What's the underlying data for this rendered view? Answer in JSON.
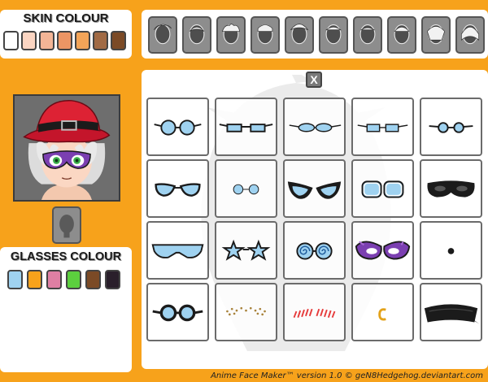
{
  "skin": {
    "title": "SKIN COLOUR",
    "colors": [
      "#ffffff",
      "#fbd5c2",
      "#f3b596",
      "#ec9564",
      "#f3a458",
      "#a16a44",
      "#7b4a26"
    ]
  },
  "hair": {
    "thumb_count": 10,
    "thumb_color": "#8d8d8d"
  },
  "glasses_colour": {
    "title": "GLASSES COLOUR",
    "colors": [
      "#9fd2f0",
      "#f7a21b",
      "#de7fa3",
      "#5ccf3e",
      "#7b4a26",
      "#2a1f2b"
    ]
  },
  "close_label": "X",
  "glasses_options": [
    "round-glasses",
    "rectangle-glasses",
    "small-oval-glasses",
    "small-rectangle-glasses",
    "round-small-glasses",
    "cat-eye-glasses",
    "wire-round-glasses",
    "black-cat-eye-mask",
    "square-frame-glasses",
    "black-eye-mask",
    "shield-sunglasses",
    "star-glasses",
    "spiral-glasses",
    "purple-masquerade-mask",
    "dot-eyes",
    "goggles",
    "freckles",
    "blush-lines",
    "earring",
    "bandana"
  ],
  "credit": "Anime Face Maker™ version 1.0 © geN8Hedgehog.deviantart.com"
}
